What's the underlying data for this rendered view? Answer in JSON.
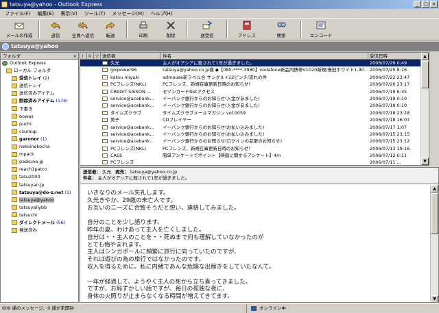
{
  "window": {
    "title": "tatsuya@yahoo - Outlook Express"
  },
  "menu": [
    "ファイル(F)",
    "編集(E)",
    "表示(V)",
    "ツール(T)",
    "メッセージ(M)",
    "ヘルプ(H)"
  ],
  "toolbar": [
    {
      "label": "メールの作成",
      "icon": "compose-mail-icon"
    },
    {
      "label": "返信",
      "icon": "reply-icon"
    },
    {
      "label": "全員へ返信",
      "icon": "reply-all-icon"
    },
    {
      "label": "転送",
      "icon": "forward-icon"
    },
    {
      "label": "印刷",
      "icon": "print-icon"
    },
    {
      "label": "削除",
      "icon": "delete-icon"
    },
    {
      "label": "送受信",
      "icon": "send-receive-icon"
    },
    {
      "label": "アドレス",
      "icon": "address-book-icon"
    },
    {
      "label": "検索",
      "icon": "find-icon"
    },
    {
      "label": "エンコード",
      "icon": "encoding-icon"
    }
  ],
  "identity": "tatsuya@yahoo",
  "folders": {
    "header": "フォルダ",
    "close": "×",
    "items": [
      {
        "label": "Outlook Express",
        "count": ""
      },
      {
        "label": "ローカル フォルダ",
        "count": ""
      },
      {
        "label": "受信トレイ",
        "count": "(2)",
        "bold": true
      },
      {
        "label": "送信トレイ",
        "count": ""
      },
      {
        "label": "送信済みアイテム",
        "count": ""
      },
      {
        "label": "削除済みアイテム",
        "count": "(176)",
        "bold": true
      },
      {
        "label": "下書き",
        "count": ""
      },
      {
        "label": "bowas",
        "count": ""
      },
      {
        "label": "puchi",
        "count": ""
      },
      {
        "label": "csumup",
        "count": ""
      },
      {
        "label": "garonor",
        "count": "(1)",
        "bold": true
      },
      {
        "label": "nekoinekocha",
        "count": ""
      },
      {
        "label": "mpack",
        "count": ""
      },
      {
        "label": "paskune.jp",
        "count": ""
      },
      {
        "label": "reach1patco",
        "count": ""
      },
      {
        "label": "tasu2000",
        "count": ""
      },
      {
        "label": "tatsuyan.jp",
        "count": ""
      },
      {
        "label": "tatsuya@do-z.net",
        "count": "(1)",
        "bold": true
      },
      {
        "label": "tatsuya@yahoo",
        "count": "",
        "selected": true
      },
      {
        "label": "tatsuyallybb",
        "count": ""
      },
      {
        "label": "tatsuchi",
        "count": ""
      },
      {
        "label": "ダイレクトメール",
        "count": "(56)",
        "bold": true
      },
      {
        "label": "発送済み",
        "count": ""
      }
    ]
  },
  "list": {
    "columns": [
      "!",
      "0",
      "▽",
      "送信者",
      "件名",
      "受信日時"
    ],
    "rows": [
      {
        "from": "久光",
        "subject": "主人がオアシアに殺されて1年が過ぎました。",
        "date": "2006/07/26 0:49",
        "selected": true
      },
      {
        "from": "goipower96",
        "subject": "tatsuya@yahoo.co.jp様 ◆【080-****-3980】vodafone新品同携帯V1020新規/復旧ホワイト1,90...",
        "date": "2006/07/25 8:16"
      },
      {
        "from": "katou miyuki",
        "subject": "admouse新ラベル合 サングル+22ピンチ/流れの件",
        "date": "2006/07/22 23:47"
      },
      {
        "from": "PCフレンズ(NKL)",
        "subject": "PCフレンズ、新規在庫更新日時のお知らせ！",
        "date": "2006/07/20 23:17"
      },
      {
        "from": "CREDIT SAISON ...",
        "subject": "セゾンカードNetアクセス",
        "date": "2006/07/19 6:35"
      },
      {
        "from": "service@acebank...",
        "subject": "イーバンク銀行からのお知らせ(入金があました)",
        "date": "2006/07/19 0:10"
      },
      {
        "from": "service@acebank...",
        "subject": "イーバンク銀行からのお知らせ(入金があました)",
        "date": "2006/07/19 0:10"
      },
      {
        "from": "タイムズクラブ",
        "subject": "タイムズクラブメールマガジン vol.0059",
        "date": "2006/07/18 23:28"
      },
      {
        "from": "美子",
        "subject": "CDプレイヤー",
        "date": "2006/07/18 16:07"
      },
      {
        "from": "service@acebank...",
        "subject": "イーバンク銀行からのお知らせ(お払い込みました)",
        "date": "2006/07/17 1:07"
      },
      {
        "from": "service@acebank...",
        "subject": "イーバンク銀行からのお知らせ(お払い込みました)",
        "date": "2006/07/15 23:15"
      },
      {
        "from": "service@acebank...",
        "subject": "イーバンク銀行からのお知らせ(ログインの変更のお知らせ)",
        "date": "2006/07/15 23:12"
      },
      {
        "from": "PCフレンズ(NKL)",
        "subject": "PCフレンズ、新規在庫更新日時のお知らせ！",
        "date": "2006/07/13 19:16"
      },
      {
        "from": "CASS",
        "subject": "簡単アンケートでポイント【映画に関するアンケート】4m",
        "date": "2006/07/12 0:11"
      },
      {
        "from": "PCフレンズ",
        "subject": "",
        "date": "2006/07/11 ..."
      }
    ]
  },
  "preview": {
    "from_label": "送信者：",
    "from": "久光",
    "to_label": "宛先：",
    "to": "tatsuya@yahoo.co.jp",
    "subject_label": "件名：",
    "subject": "主人がオアシアに殺されて1年が過ぎました。",
    "body": [
      "いきなりのメール失礼します。",
      "久光きやか、29歳の未亡人です。",
      "お互いのニーズに合致そうだと想い、連絡してみました。",
      "",
      "自分のことを少し語ります。",
      "昨年の夏、わけあって主人を亡くしました。",
      "自分は・・主人のことを・・死ぬまで何も理解していなかったのが",
      "とても悔やまれます。",
      "主人はシンガポールに頻繁に旅行に向っていたのですが、",
      "それは遊びの為の旅行ではなかったのです。",
      "収入を得るために、私に内緒であんな危険な出稼ぎをしていたなんて。",
      "",
      "一年が経過して、ようやく主人の死から立ち直ってきました。",
      "ですが、お恥ずかしい話ですが、毎日の孤独な夜に、",
      "身体の火照りが止まらなくなる時間が増えてきてます。"
    ]
  },
  "status": {
    "left": "609 通のメッセージ、0 通が未開封",
    "right": "オンライン中"
  }
}
